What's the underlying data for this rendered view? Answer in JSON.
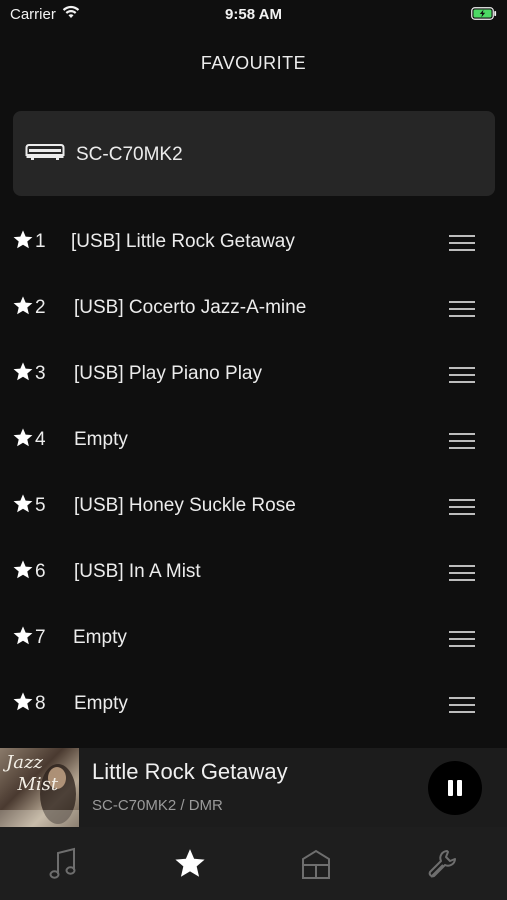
{
  "status_bar": {
    "carrier": "Carrier",
    "time": "9:58 AM"
  },
  "header": {
    "title": "FAVOURITE"
  },
  "device": {
    "name": "SC-C70MK2"
  },
  "favourites": [
    {
      "number": "1",
      "title": "[USB] Little Rock Getaway"
    },
    {
      "number": "2",
      "title": "[USB] Cocerto Jazz-A-mine"
    },
    {
      "number": "3",
      "title": "[USB] Play Piano Play"
    },
    {
      "number": "4",
      "title": "Empty"
    },
    {
      "number": "5",
      "title": "[USB] Honey Suckle Rose"
    },
    {
      "number": "6",
      "title": "[USB] In A Mist"
    },
    {
      "number": "7",
      "title": "Empty"
    },
    {
      "number": "8",
      "title": "Empty"
    }
  ],
  "now_playing": {
    "title": "Little Rock Getaway",
    "source": "SC-C70MK2 / DMR",
    "album_art_lettering": "Jazz Mist"
  },
  "tab_bar": {
    "tabs": [
      {
        "icon": "music-note-icon",
        "active": false
      },
      {
        "icon": "star-icon",
        "active": true
      },
      {
        "icon": "home-icon",
        "active": false
      },
      {
        "icon": "wrench-icon",
        "active": false
      }
    ]
  },
  "colors": {
    "background": "#0f0f0f",
    "card": "#262626",
    "accent_active": "#ffffff",
    "inactive_icon": "#6e6e6e"
  }
}
